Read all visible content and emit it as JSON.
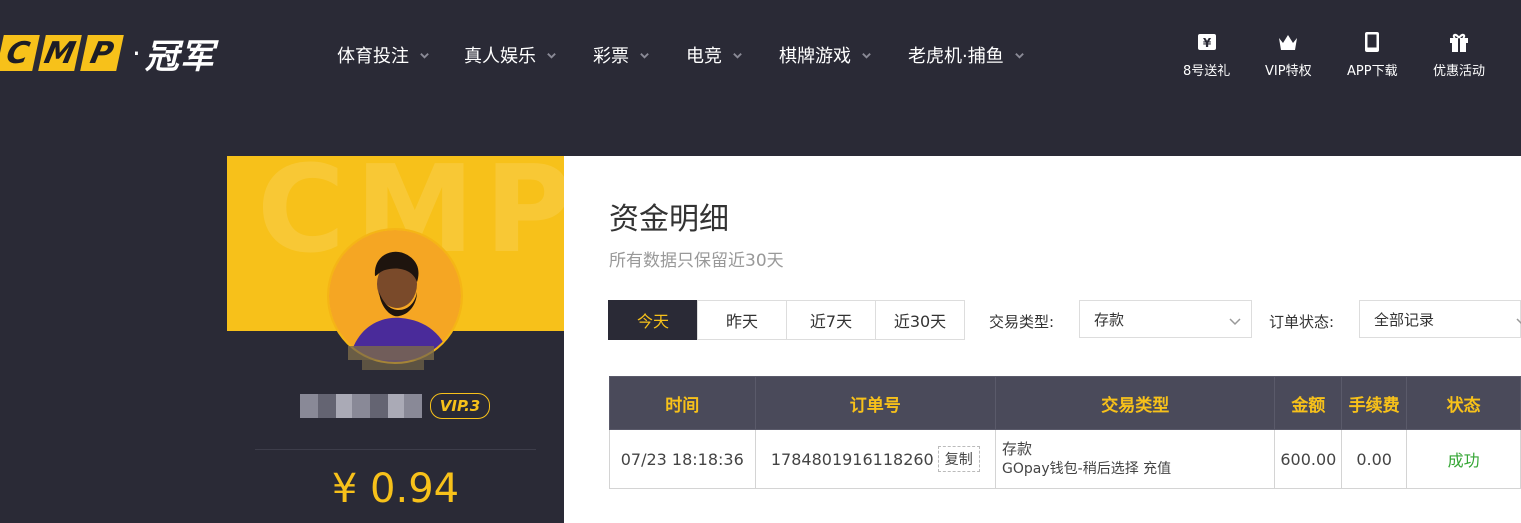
{
  "header": {
    "logo_letters": [
      "C",
      "M",
      "P"
    ],
    "logo_dot": "·",
    "logo_cn": "冠军",
    "brand_color": "#f7c11a",
    "nav": [
      {
        "label": "体育投注",
        "icon": "chevron-down-icon"
      },
      {
        "label": "真人娱乐",
        "icon": "chevron-down-icon"
      },
      {
        "label": "彩票",
        "icon": "chevron-down-icon"
      },
      {
        "label": "电竞",
        "icon": "chevron-down-icon"
      },
      {
        "label": "棋牌游戏",
        "icon": "chevron-down-icon"
      },
      {
        "label": "老虎机·捕鱼",
        "icon": "chevron-down-icon"
      }
    ],
    "quick_links": [
      {
        "label": "8号送礼",
        "icon": "ticket-icon"
      },
      {
        "label": "VIP特权",
        "icon": "crown-icon"
      },
      {
        "label": "APP下载",
        "icon": "tablet-icon"
      },
      {
        "label": "优惠活动",
        "icon": "gift-icon"
      }
    ]
  },
  "profile": {
    "watermark": "CMP",
    "vip_level": "VIP.3",
    "balance": "¥ 0.94"
  },
  "main": {
    "title": "资金明细",
    "subtitle": "所有数据只保留近30天",
    "date_tabs": [
      "今天",
      "昨天",
      "近7天",
      "近30天"
    ],
    "active_tab": "今天",
    "filter_type_label": "交易类型:",
    "filter_type_value": "存款",
    "filter_status_label": "订单状态:",
    "filter_status_value": "全部记录",
    "table": {
      "headers": [
        "时间",
        "订单号",
        "交易类型",
        "金额",
        "手续费",
        "状态"
      ],
      "rows": [
        {
          "time": "07/23 18:18:36",
          "order_no": "1784801916118260",
          "copy_label": "复制",
          "type_main": "存款",
          "type_detail": "GOpay钱包-稍后选择 充值",
          "amount": "600.00",
          "fee": "0.00",
          "status": "成功"
        }
      ]
    }
  }
}
